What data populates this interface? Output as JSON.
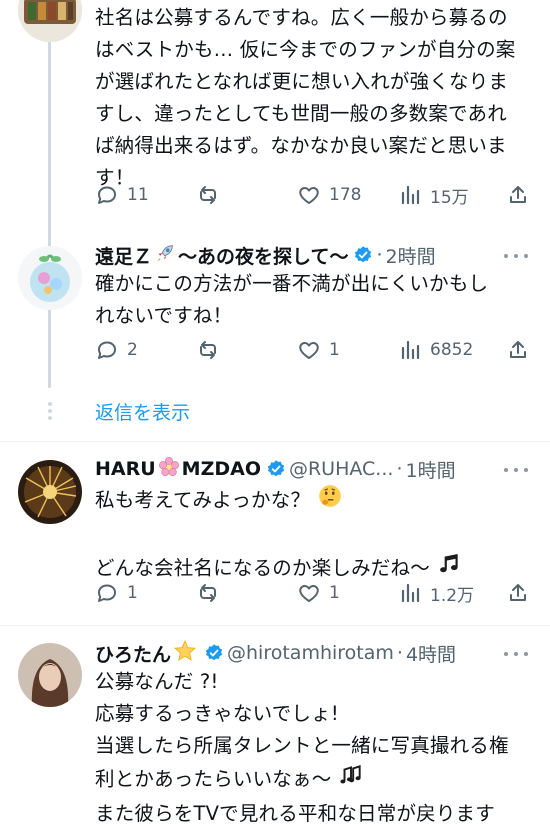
{
  "tweet_top": {
    "lines": [
      "社名は公募するんですね。広く一般から募るの",
      "はベストかも… 仮に今までのファンが自分の案",
      "が選ばれたとなれば更に想い入れが強くなりま",
      "すし、違ったとしても世間一般の多数案であれ",
      "ば納得出来るはず。なかなか良い案だと思いま",
      "す！"
    ],
    "replies": "11",
    "retweets": "",
    "likes": "178",
    "views": "15万"
  },
  "reply_ensoku": {
    "name_prefix": "遠足Ｚ",
    "name_suffix": "～あの夜を探して～",
    "dot": "·",
    "time": "2時間",
    "lines": [
      "確かにこの方法が一番不満が出にくいかもし",
      "れないですね！"
    ],
    "replies": "2",
    "retweets": "",
    "likes": "1",
    "views": "6852"
  },
  "show_replies": "返信を表示",
  "tweet_haru": {
    "name_prefix": "HARU",
    "name_suffix": "MZDAO",
    "handle": "@RUHAC...",
    "dot": "·",
    "time": "1時間",
    "line1": "私も考えてみよっかな？",
    "line2": "どんな会社名になるのか楽しみだね～",
    "replies": "1",
    "retweets": "",
    "likes": "1",
    "views": "1.2万"
  },
  "tweet_hiro": {
    "name": "ひろたん",
    "handle": "@hirotamhirotam",
    "dot": "·",
    "time": "4時間",
    "lines": [
      "公募なんだ ?!",
      "応募するっきゃないでしょ!",
      "当選したら所属タレントと一緒に写真撮れる権",
      "利とかあったらいいなぁ～",
      "また彼らをTVで見れる平和な日常が戻ります"
    ]
  },
  "colors": {
    "accent": "#1d9bf0",
    "secondary_text": "#536471",
    "verified_blue": "#1d9bf0",
    "divider": "#eff3f4"
  }
}
